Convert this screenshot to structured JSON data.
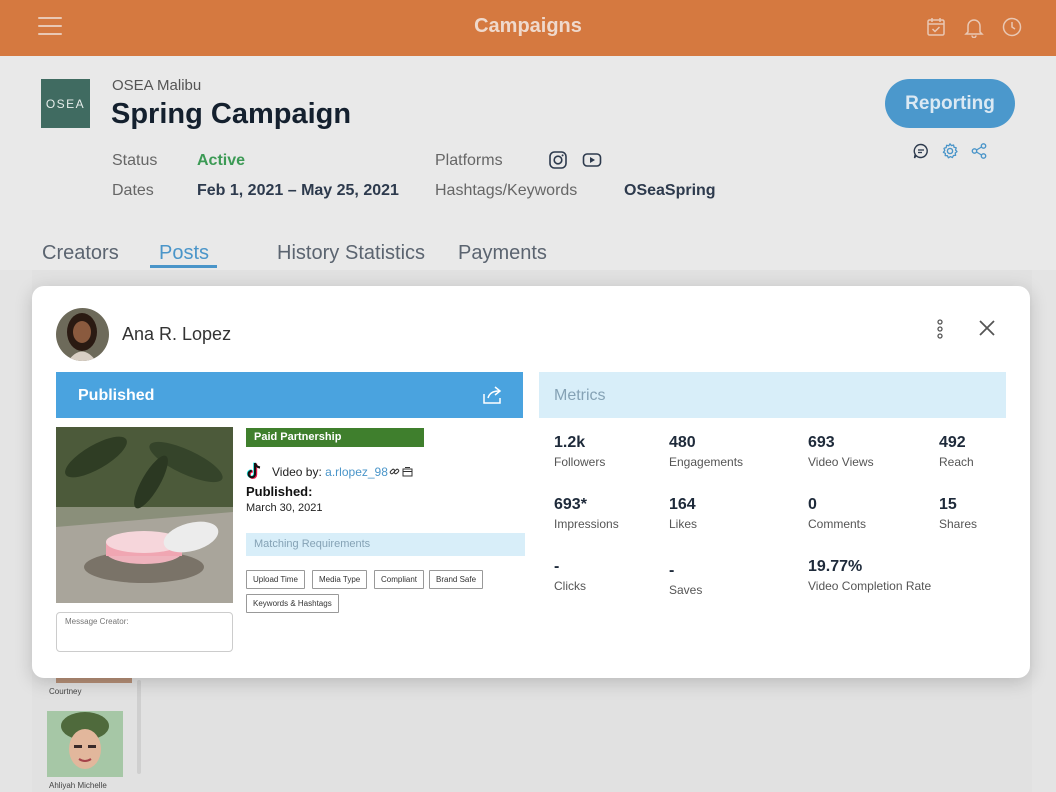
{
  "app": {
    "title": "Campaigns"
  },
  "header": {
    "logo_text": "OSEA",
    "brand": "OSEA Malibu",
    "campaign_title": "Spring Campaign",
    "status_label": "Status",
    "status_value": "Active",
    "dates_label": "Dates",
    "dates_value": "Feb 1, 2021 – May 25, 2021",
    "platforms_label": "Platforms",
    "platforms": [
      "instagram-icon",
      "youtube-icon"
    ],
    "hashtags_label": "Hashtags/Keywords",
    "hashtags_value": "OSeaSpring",
    "reporting_button": "Reporting",
    "status_color": "#3c9a55",
    "accent_color": "#4a95c9",
    "brand_color": "#d4631e"
  },
  "tabs": [
    {
      "label": "Creators"
    },
    {
      "label": "Posts"
    },
    {
      "label": "History"
    },
    {
      "label": "Statistics"
    },
    {
      "label": "Payments"
    }
  ],
  "active_tab": "Posts",
  "background_list": [
    {
      "name": "Courtney"
    },
    {
      "name": "Ahliyah Michelle"
    }
  ],
  "modal": {
    "creator_name": "Ana R. Lopez",
    "published_label": "Published",
    "metrics_label": "Metrics",
    "paid_badge": "Paid Partnership",
    "video_by_label": "Video by:",
    "video_by_handle": "a.rlopez_98",
    "published_field_label": "Published:",
    "published_date": "March 30, 2021",
    "matching_label": "Matching Requirements",
    "requirements": [
      "Upload Time",
      "Media Type",
      "Compliant",
      "Brand Safe",
      "Keywords & Hashtags"
    ],
    "message_placeholder": "Message Creator:",
    "metrics": [
      {
        "value": "1.2k",
        "label": "Followers"
      },
      {
        "value": "480",
        "label": "Engagements"
      },
      {
        "value": "693",
        "label": "Video Views"
      },
      {
        "value": "492",
        "label": "Reach"
      },
      {
        "value": "693*",
        "label": "Impressions"
      },
      {
        "value": "164",
        "label": "Likes"
      },
      {
        "value": "0",
        "label": "Comments"
      },
      {
        "value": "15",
        "label": "Shares"
      },
      {
        "value": "-",
        "label": "Clicks"
      },
      {
        "value": "-",
        "label": "Saves"
      },
      {
        "value": "19.77%",
        "label": "Video Completion Rate"
      }
    ]
  }
}
